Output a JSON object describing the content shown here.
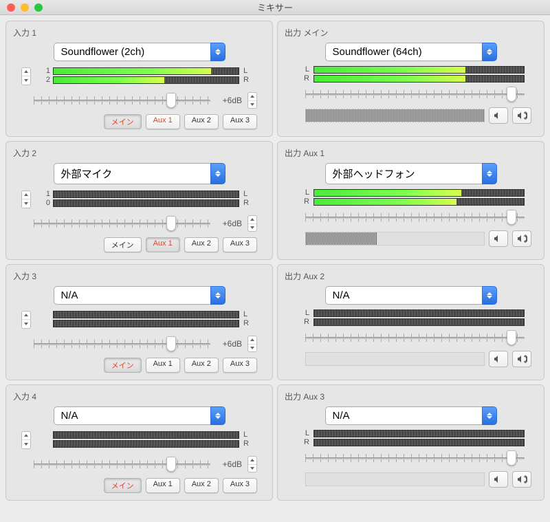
{
  "window": {
    "title": "ミキサー"
  },
  "inputs": [
    {
      "title": "入力 1",
      "device": "Soundflower (2ch)",
      "ch": [
        "1",
        "2"
      ],
      "lab": [
        "L",
        "R"
      ],
      "fill": [
        85,
        60
      ],
      "thumb": 78,
      "db": "+6dB",
      "routes": [
        {
          "label": "メイン",
          "active": true,
          "accent": true
        },
        {
          "label": "Aux 1",
          "active": false,
          "accent": true
        },
        {
          "label": "Aux 2",
          "active": false,
          "accent": false
        },
        {
          "label": "Aux 3",
          "active": false,
          "accent": false
        }
      ]
    },
    {
      "title": "入力 2",
      "device": "外部マイク",
      "ch": [
        "1",
        "0"
      ],
      "lab": [
        "L",
        "R"
      ],
      "fill": [
        0,
        0
      ],
      "thumb": 78,
      "db": "+6dB",
      "routes": [
        {
          "label": "メイン",
          "active": false,
          "accent": false
        },
        {
          "label": "Aux 1",
          "active": true,
          "accent": true
        },
        {
          "label": "Aux 2",
          "active": false,
          "accent": false
        },
        {
          "label": "Aux 3",
          "active": false,
          "accent": false
        }
      ]
    },
    {
      "title": "入力 3",
      "device": "N/A",
      "ch": [
        "",
        ""
      ],
      "lab": [
        "L",
        "R"
      ],
      "fill": [
        0,
        0
      ],
      "thumb": 78,
      "db": "+6dB",
      "routes": [
        {
          "label": "メイン",
          "active": true,
          "accent": true
        },
        {
          "label": "Aux 1",
          "active": false,
          "accent": false
        },
        {
          "label": "Aux 2",
          "active": false,
          "accent": false
        },
        {
          "label": "Aux 3",
          "active": false,
          "accent": false
        }
      ]
    },
    {
      "title": "入力 4",
      "device": "N/A",
      "ch": [
        "",
        ""
      ],
      "lab": [
        "L",
        "R"
      ],
      "fill": [
        0,
        0
      ],
      "thumb": 78,
      "db": "+6dB",
      "routes": [
        {
          "label": "メイン",
          "active": true,
          "accent": true
        },
        {
          "label": "Aux 1",
          "active": false,
          "accent": false
        },
        {
          "label": "Aux 2",
          "active": false,
          "accent": false
        },
        {
          "label": "Aux 3",
          "active": false,
          "accent": false
        }
      ]
    }
  ],
  "outputs": [
    {
      "title": "出力 メイン",
      "device": "Soundflower (64ch)",
      "lab": [
        "L",
        "R"
      ],
      "fill": [
        72,
        72
      ],
      "thumb": 94,
      "wave": 100
    },
    {
      "title": "出力 Aux 1",
      "device": "外部ヘッドフォン",
      "lab": [
        "L",
        "R"
      ],
      "fill": [
        70,
        68
      ],
      "thumb": 94,
      "wave": 40
    },
    {
      "title": "出力 Aux 2",
      "device": "N/A",
      "lab": [
        "L",
        "R"
      ],
      "fill": [
        0,
        0
      ],
      "thumb": 94,
      "wave": 0
    },
    {
      "title": "出力 Aux 3",
      "device": "N/A",
      "lab": [
        "L",
        "R"
      ],
      "fill": [
        0,
        0
      ],
      "thumb": 94,
      "wave": 0
    }
  ]
}
